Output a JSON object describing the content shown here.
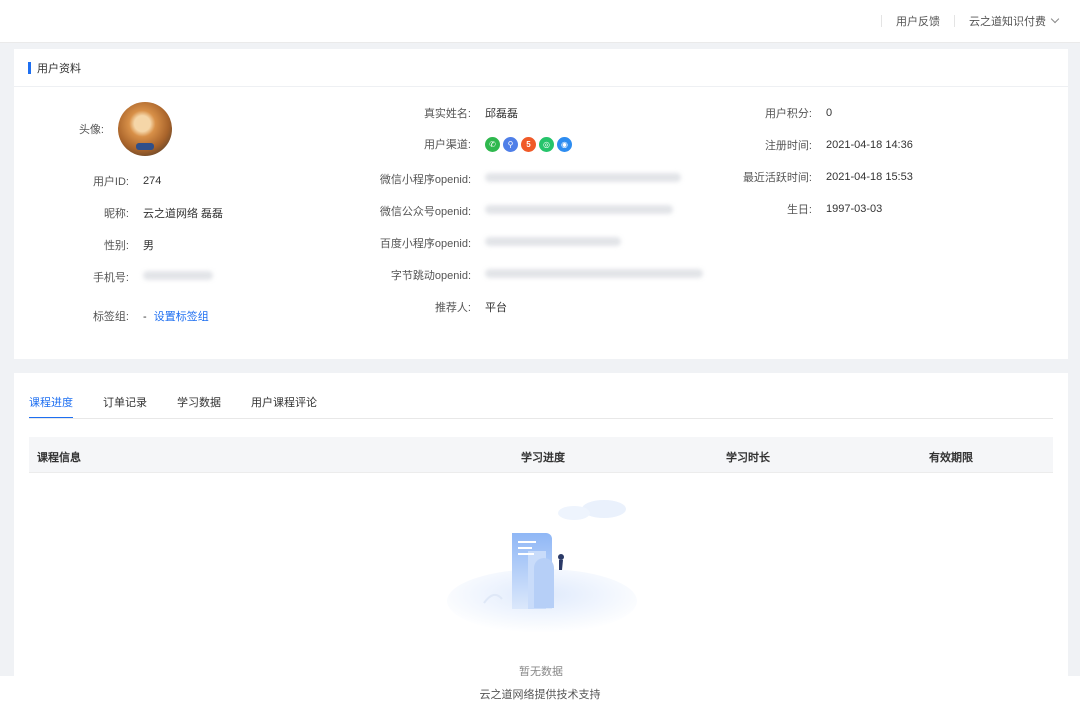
{
  "header": {
    "feedback_label": "用户反馈",
    "company_label": "云之道知识付费"
  },
  "profile": {
    "section_title": "用户资料",
    "avatar_label": "头像:",
    "user_id_label": "用户ID:",
    "user_id": "274",
    "nickname_label": "昵称:",
    "nickname": "云之道网络 磊磊",
    "gender_label": "性别:",
    "gender": "男",
    "phone_label": "手机号:",
    "tag_group_label": "标签组:",
    "tag_group_dash": "-",
    "tag_group_link": "设置标签组",
    "real_name_label": "真实姓名:",
    "real_name": "邱磊磊",
    "channel_label": "用户渠道:",
    "channels": [
      {
        "icon": "wechat-icon",
        "color": "#2fb84e",
        "glyph": "✆"
      },
      {
        "icon": "link-icon",
        "color": "#4f7fe8",
        "glyph": "⚲"
      },
      {
        "icon": "h5-icon",
        "color": "#f05a28",
        "glyph": "5"
      },
      {
        "icon": "miniapp-icon",
        "color": "#26c46b",
        "glyph": "◎"
      },
      {
        "icon": "bytedance-icon",
        "color": "#2d8cf0",
        "glyph": "◉"
      }
    ],
    "wx_mini_openid_label": "微信小程序openid:",
    "wx_mp_openid_label": "微信公众号openid:",
    "baidu_openid_label": "百度小程序openid:",
    "bytedance_openid_label": "字节跳动openid:",
    "referrer_label": "推荐人:",
    "referrer": "平台",
    "points_label": "用户积分:",
    "points": "0",
    "register_label": "注册时间:",
    "register_time": "2021-04-18 14:36",
    "last_active_label": "最近活跃时间:",
    "last_active_time": "2021-04-18 15:53",
    "birthday_label": "生日:",
    "birthday": "1997-03-03"
  },
  "tabs": [
    "课程进度",
    "订单记录",
    "学习数据",
    "用户课程评论"
  ],
  "table": {
    "columns": [
      "课程信息",
      "学习进度",
      "学习时长",
      "有效期限"
    ],
    "empty_text": "暂无数据"
  },
  "footer": {
    "text": "云之道网络提供技术支持"
  },
  "colors": {
    "accent": "#1e6ff1"
  }
}
